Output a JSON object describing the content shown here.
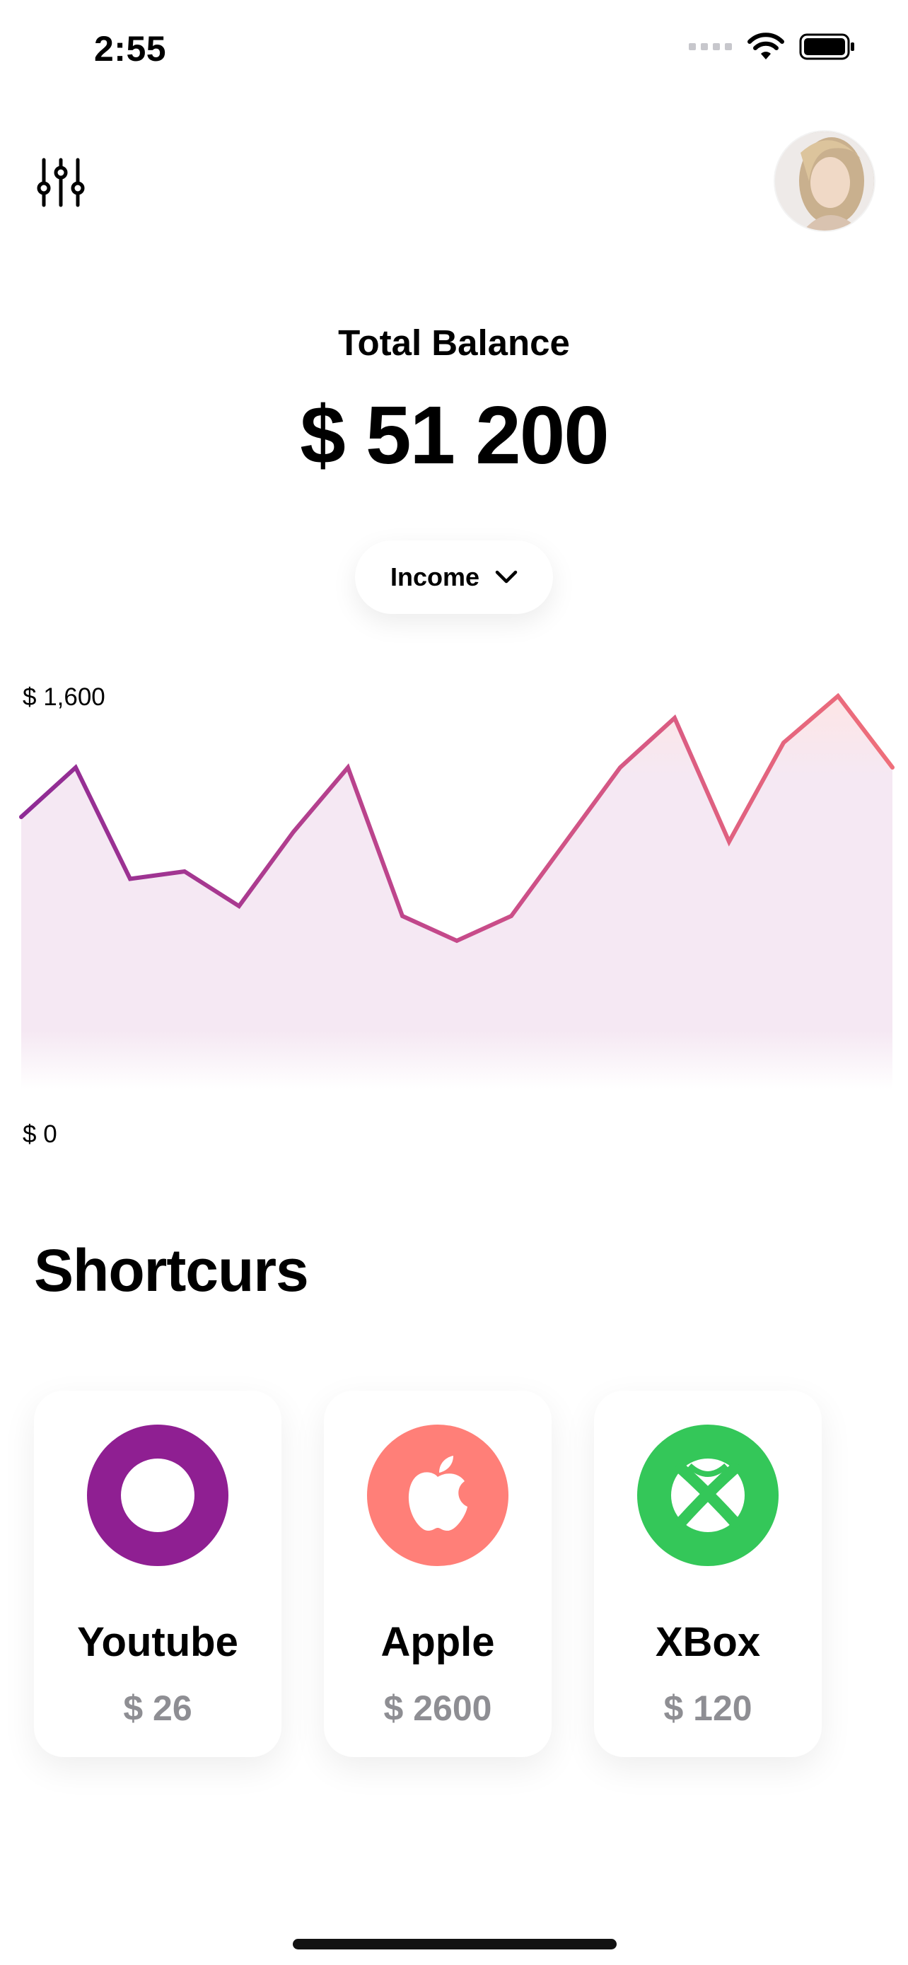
{
  "status_bar": {
    "time": "2:55",
    "signal_icon": "cellular-dots-icon",
    "wifi_icon": "wifi-icon",
    "battery_icon": "battery-icon"
  },
  "header": {
    "filter_icon": "sliders-icon",
    "avatar_icon": "user-avatar"
  },
  "balance": {
    "label": "Total Balance",
    "value": "$ 51 200"
  },
  "filter": {
    "selected": "Income",
    "icon": "chevron-down-icon"
  },
  "chart_data": {
    "type": "area",
    "y_axis_labels": [
      "$ 1,600",
      "$ 0"
    ],
    "ylim": [
      0,
      1600
    ],
    "x": [
      0,
      1,
      2,
      3,
      4,
      5,
      6,
      7,
      8,
      9,
      10,
      11,
      12,
      13,
      14,
      15,
      16
    ],
    "values": [
      1100,
      1300,
      850,
      880,
      740,
      1040,
      1300,
      700,
      600,
      700,
      1000,
      1300,
      1500,
      1000,
      1400,
      1700,
      1300
    ],
    "gradient_colors": [
      "#8e2a95",
      "#c64a8a",
      "#ef6f7a"
    ],
    "fill_color": "#f5e8f3"
  },
  "shortcuts": {
    "title": "Shortcurs",
    "items": [
      {
        "name": "Youtube",
        "amount": "$ 26",
        "icon": "ring-icon",
        "color": "#8f1f92"
      },
      {
        "name": "Apple",
        "amount": "$ 2600",
        "icon": "apple-icon",
        "color": "#ff7f78"
      },
      {
        "name": "XBox",
        "amount": "$ 120",
        "icon": "xbox-icon",
        "color": "#34c759"
      }
    ]
  }
}
